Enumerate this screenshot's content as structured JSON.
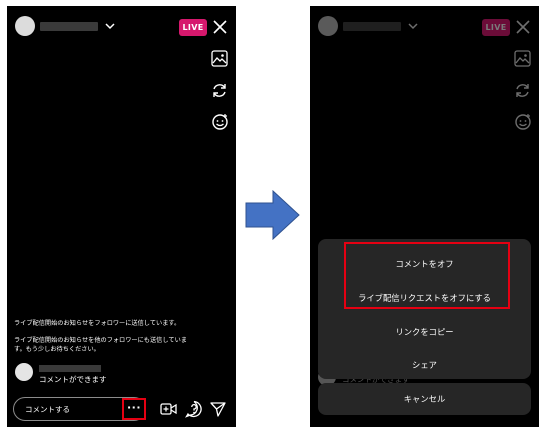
{
  "left_screen": {
    "live_badge": "LIVE",
    "notice_line1": "ライブ配信開始のお知らせをフォロワーに送信しています。",
    "notice_line2": "ライブ配信開始のお知らせを他のフォロワーにも送信していま",
    "notice_line3": "す。もう少しお待ちください。",
    "comment_status": "コメントができます",
    "comment_placeholder": "コメントする",
    "more_button": "···"
  },
  "right_screen": {
    "live_badge": "LIVE",
    "comment_status": "コメントができます",
    "sheet": {
      "item1": "コメントをオフ",
      "item2": "ライブ配信リクエストをオフにする",
      "item3": "リンクをコピー",
      "item4": "シェア"
    },
    "cancel": "キャンセル"
  },
  "colors": {
    "live_badge": "#d6186d",
    "highlight_border": "#e50012",
    "arrow": "#4472c4",
    "sheet_background": "#262626"
  },
  "icons": [
    "chevron-down-icon",
    "close-icon",
    "image-icon",
    "flip-camera-icon",
    "face-effects-icon",
    "add-video-icon",
    "question-icon",
    "send-icon",
    "right-arrow-icon"
  ]
}
